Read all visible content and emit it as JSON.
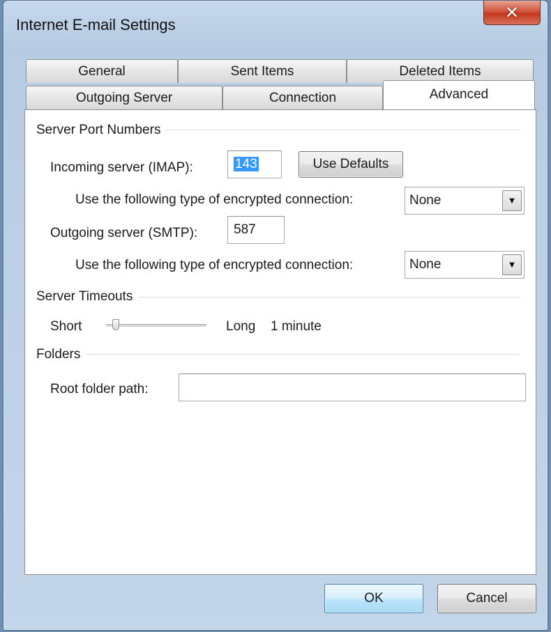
{
  "window": {
    "title": "Internet E-mail Settings"
  },
  "tabs": {
    "row1": [
      "General",
      "Sent Items",
      "Deleted Items"
    ],
    "row2": [
      "Outgoing Server",
      "Connection",
      "Advanced"
    ],
    "active": "Advanced"
  },
  "ports": {
    "group_label": "Server Port Numbers",
    "incoming_label": "Incoming server (IMAP):",
    "incoming_value": "143",
    "use_defaults_label": "Use Defaults",
    "encryption_label_1": "Use the following type of encrypted connection:",
    "encryption_value_1": "None",
    "outgoing_label": "Outgoing server (SMTP):",
    "outgoing_value": "587",
    "encryption_label_2": "Use the following type of encrypted connection:",
    "encryption_value_2": "None"
  },
  "timeouts": {
    "group_label": "Server Timeouts",
    "short_label": "Short",
    "long_label": "Long",
    "value_text": "1 minute",
    "slider_fraction": 0.1
  },
  "folders": {
    "group_label": "Folders",
    "root_path_label": "Root folder path:",
    "root_path_value": ""
  },
  "footer": {
    "ok_label": "OK",
    "cancel_label": "Cancel"
  },
  "icons": {
    "close": "close-icon",
    "dropdown": "chevron-down-icon",
    "slider": "slider-thumb"
  },
  "colors": {
    "titlebar": "#b9cde4",
    "close_button": "#c9442a",
    "selection": "#3399ff"
  }
}
